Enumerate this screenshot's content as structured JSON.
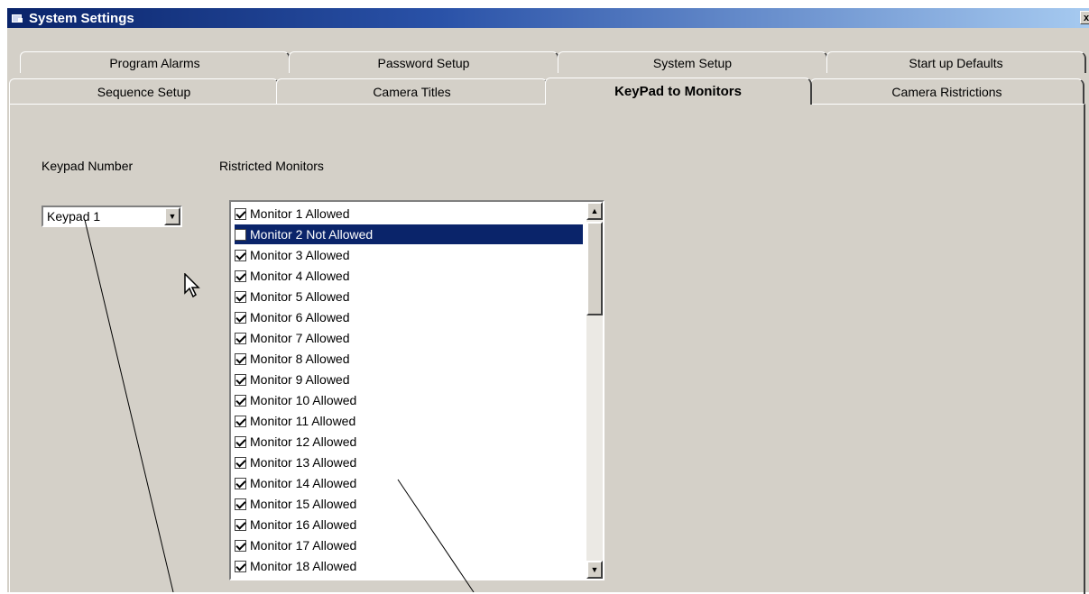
{
  "window": {
    "title": "System Settings",
    "close_label": "x",
    "app_icon": "window-app-icon"
  },
  "tabs_back": [
    "Program Alarms",
    "Password Setup",
    "System Setup",
    "Start up Defaults"
  ],
  "tabs_front": [
    "Sequence Setup",
    "Camera Titles",
    "KeyPad to Monitors",
    "Camera Ristrictions"
  ],
  "active_tab": "KeyPad to Monitors",
  "keypad": {
    "label": "Keypad Number",
    "value": "Keypad 1",
    "arrow": "▼"
  },
  "monitors": {
    "label": "Ristricted Monitors",
    "selected_index": 1,
    "items": [
      {
        "label": "Monitor 1 Allowed",
        "checked": true
      },
      {
        "label": "Monitor 2 Not Allowed",
        "checked": false
      },
      {
        "label": "Monitor 3 Allowed",
        "checked": true
      },
      {
        "label": "Monitor 4 Allowed",
        "checked": true
      },
      {
        "label": "Monitor 5 Allowed",
        "checked": true
      },
      {
        "label": "Monitor 6 Allowed",
        "checked": true
      },
      {
        "label": "Monitor 7 Allowed",
        "checked": true
      },
      {
        "label": "Monitor 8 Allowed",
        "checked": true
      },
      {
        "label": "Monitor 9 Allowed",
        "checked": true
      },
      {
        "label": "Monitor 10 Allowed",
        "checked": true
      },
      {
        "label": "Monitor 11 Allowed",
        "checked": true
      },
      {
        "label": "Monitor 12 Allowed",
        "checked": true
      },
      {
        "label": "Monitor 13 Allowed",
        "checked": true
      },
      {
        "label": "Monitor 14 Allowed",
        "checked": true
      },
      {
        "label": "Monitor 15 Allowed",
        "checked": true
      },
      {
        "label": "Monitor 16 Allowed",
        "checked": true
      },
      {
        "label": "Monitor 17 Allowed",
        "checked": true
      },
      {
        "label": "Monitor 18 Allowed",
        "checked": true
      }
    ],
    "scroll_up": "▲",
    "scroll_down": "▼"
  }
}
